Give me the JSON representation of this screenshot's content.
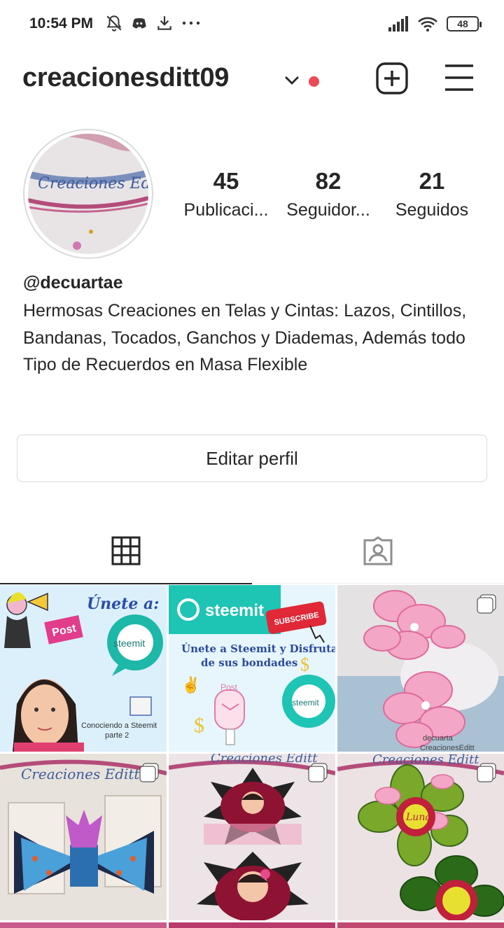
{
  "status_bar": {
    "time": "10:54 PM",
    "battery": "48",
    "icons": [
      "mute-icon",
      "discord-icon",
      "download-icon",
      "more-icon",
      "signal-icon",
      "wifi-icon",
      "battery-icon"
    ]
  },
  "header": {
    "username": "creacionesditt09",
    "notification_color": "#ed4956"
  },
  "profile": {
    "stats": [
      {
        "value": "45",
        "label": "Publicaci..."
      },
      {
        "value": "82",
        "label": "Seguidor..."
      },
      {
        "value": "21",
        "label": "Seguidos"
      }
    ],
    "handle": "@decuartae",
    "bio": "Hermosas Creaciones en Telas y Cintas: Lazos, Cintillos, Bandanas, Tocados, Ganchos y Diademas, Además todo Tipo de Recuerdos en Masa Flexible"
  },
  "edit_button": "Editar perfil",
  "tabs": [
    {
      "name": "grid",
      "icon": "grid-icon",
      "active": true
    },
    {
      "name": "tagged",
      "icon": "tagged-icon",
      "active": false
    }
  ],
  "posts": [
    {
      "title": "Únete a:",
      "brand": "steemit",
      "caption": "Conociendo a Steemit parte 2",
      "multi": false
    },
    {
      "title": "steemit",
      "subtitle": "Únete a Steemit y Disfruta de sus bondades",
      "badge": "SUBSCRIBE",
      "multi": false
    },
    {
      "caption": "decuarta CreacionesEditt",
      "multi": true
    },
    {
      "watermark": "Creaciones Editt",
      "multi": true
    },
    {
      "watermark": "Creaciones Editt",
      "multi": true
    },
    {
      "watermark": "Creaciones Editt",
      "badge": "Luna",
      "multi": true
    }
  ]
}
